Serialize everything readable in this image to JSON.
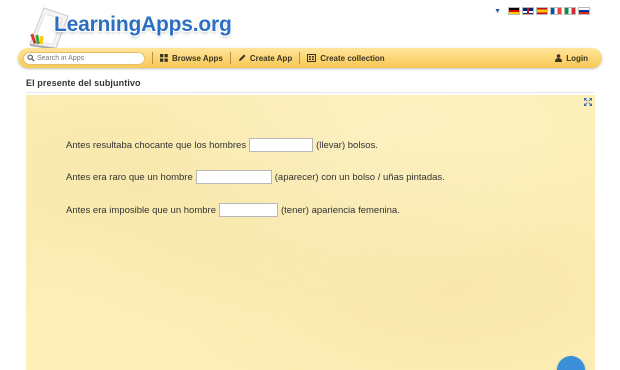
{
  "header": {
    "logo_text": "LearningApps.org",
    "languages": [
      "de",
      "en",
      "es",
      "fr",
      "it",
      "ru"
    ]
  },
  "nav": {
    "search_placeholder": "Search in Apps",
    "browse_label": "Browse Apps",
    "create_label": "Create App",
    "collection_label": "Create collection",
    "login_label": "Login"
  },
  "app": {
    "title": "El presente del subjuntivo"
  },
  "exercise": {
    "sentences": [
      {
        "before": "Antes resultaba chocante que los hombres",
        "value": "",
        "after": "(llevar) bolsos."
      },
      {
        "before": "Antes era raro que un hombre",
        "value": "",
        "after": "(aparecer) con un bolso / uñas pintadas."
      },
      {
        "before": "Antes era imposible que un hombre",
        "value": "",
        "after": "(tener) apariencia femenina."
      }
    ]
  },
  "colors": {
    "logo_blue": "#2b6fc2",
    "nav_bar": "#f7c855",
    "exercise_bg": "#fcefb8",
    "check_button": "#3a8fd8"
  }
}
